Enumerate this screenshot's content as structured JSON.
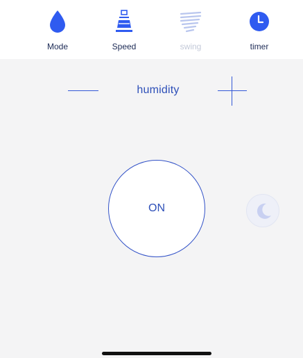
{
  "tabs": {
    "mode": {
      "label": "Mode",
      "icon": "water-drop-icon"
    },
    "speed": {
      "label": "Speed",
      "icon": "fan-speed-icon"
    },
    "swing": {
      "label": "swing",
      "icon": "swing-icon",
      "enabled": false
    },
    "timer": {
      "label": "timer",
      "icon": "clock-icon"
    }
  },
  "control": {
    "label": "humidity",
    "decrease_icon": "minus-icon",
    "increase_icon": "plus-icon"
  },
  "power": {
    "label": "ON"
  },
  "sleep": {
    "icon": "moon-icon"
  },
  "colors": {
    "accent": "#2f5bf0",
    "text_primary": "#1c2a55",
    "text_disabled": "#c3c9d8",
    "background": "#f4f4f5"
  }
}
